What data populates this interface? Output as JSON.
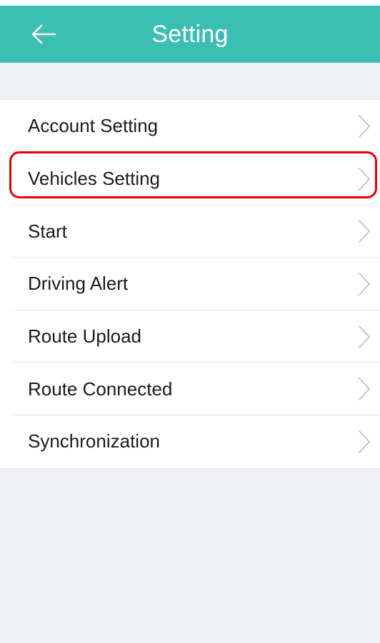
{
  "header": {
    "title": "Setting",
    "back_icon": "arrow-left-icon",
    "color": "#3bbfb3"
  },
  "menu": {
    "items": [
      {
        "label": "Account Setting",
        "icon": "chevron-right-icon"
      },
      {
        "label": "Vehicles Setting",
        "icon": "chevron-right-icon",
        "highlighted": true
      },
      {
        "label": "Start",
        "icon": "chevron-right-icon"
      },
      {
        "label": "Driving Alert",
        "icon": "chevron-right-icon"
      },
      {
        "label": "Route Upload",
        "icon": "chevron-right-icon"
      },
      {
        "label": "Route Connected",
        "icon": "chevron-right-icon"
      },
      {
        "label": "Synchronization",
        "icon": "chevron-right-icon"
      }
    ]
  },
  "colors": {
    "accent": "#3bbfb3",
    "highlight_border": "#e8000e",
    "background": "#eff0f4"
  }
}
